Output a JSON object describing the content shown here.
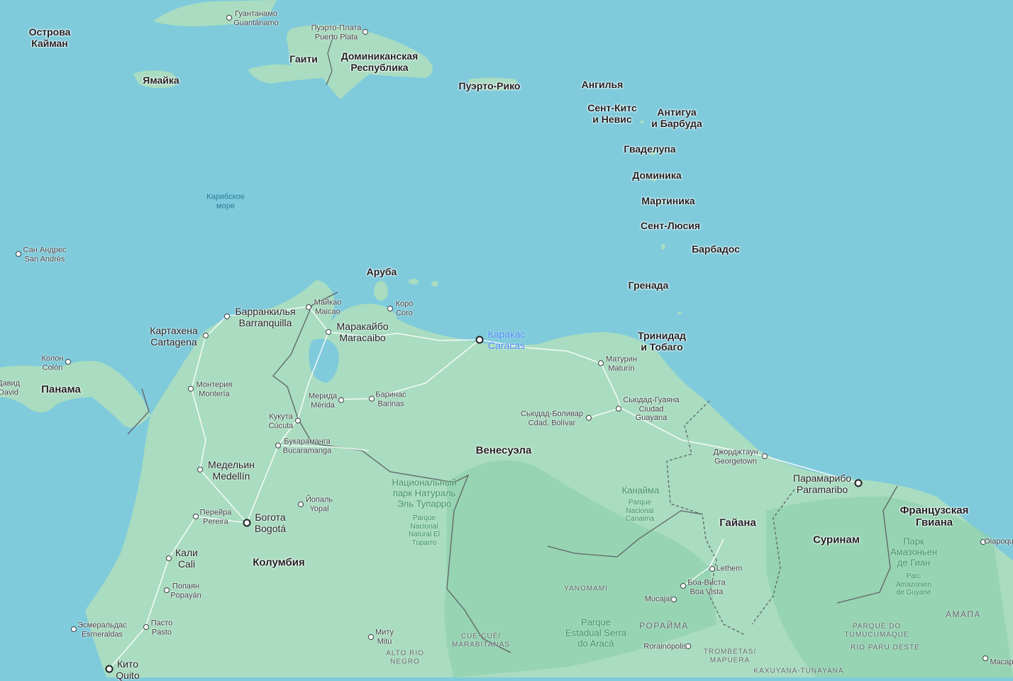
{
  "colors": {
    "water": "#7fcbdc",
    "land": "#a9dcc0",
    "land_dark": "#8fd0ae",
    "border": "#5f6368",
    "road": "#ffffff"
  },
  "countries": {
    "cayman": "Острова\nКайман",
    "jamaica": "Ямайка",
    "haiti": "Гаити",
    "dominican": "Доминиканская\nРеспублика",
    "puerto_rico": "Пуэрто-Рико",
    "anguilla": "Ангилья",
    "st_kitts": "Сент-Китс\nи Невис",
    "antigua": "Антигуа\nи Барбуда",
    "guadeloupe": "Гваделупа",
    "dominica": "Доминика",
    "martinique": "Мартиника",
    "st_lucia": "Сент-Люсия",
    "barbados": "Барбадос",
    "grenada": "Гренада",
    "trinidad": "Тринидад\nи Тобаго",
    "aruba": "Аруба",
    "panama": "Панама",
    "venezuela": "Венесуэла",
    "colombia": "Колумбия",
    "guyana": "Гайана",
    "suriname": "Суринам",
    "french_guiana": "Французская\nГвиана"
  },
  "sea": {
    "caribbean": "Карибское\nморе"
  },
  "cities": {
    "guantanamo": "Гуантанамо\nGuantánamo",
    "puerto_plata": "Пуэрто-Плата\nPuerto Plata",
    "san_andres": "Сан Андрес\nSan Andrés",
    "maicao": "Майкао\nMaicao",
    "coro": "Коро\nCoro",
    "barranquilla": "Барранкилья\nBarranquilla",
    "maracaibo": "Маракайбо\nMaracaibo",
    "cartagena": "Картахена\nCartagena",
    "colon": "Колон\nColón",
    "david": "Давид\nDavid",
    "maturin": "Матурин\nMaturín",
    "monteria": "Монтерия\nMontería",
    "merida": "Мерида\nMérida",
    "barinas": "Баринас\nBarinas",
    "cucuta": "Кукута\nCúcuta",
    "ciudad_guayana": "Сьюдад-Гуаяна\nCiudad\nGuayana",
    "ciudad_bolivar": "Сьюдад-Боливар\nCdad. Bolívar",
    "bucaramanga": "Букараманга\nBucaramanga",
    "georgetown": "Джорджтаун\nGeorgetown",
    "medellin": "Медельин\nMedellín",
    "paramaribo": "Парамарибо\nParamaribo",
    "yopal": "Йопаль\nYopal",
    "pereira": "Перейра\nPereira",
    "bogota": "Богота\nBogotá",
    "cali": "Кали\nCali",
    "popayan": "Попаян\nPopayán",
    "esmeraldas": "Эсмеральдас\nEsmeraldas",
    "pasto": "Пасто\nPasto",
    "quito": "Кито\nQuito",
    "mitu": "Миту\nMitú",
    "lethem": "Lethem",
    "boa_vista": "Боа-Виста\nBoa Vista",
    "mucajai": "Mucajaí",
    "rorainopolis": "Rorainópolis",
    "oiapoque": "Oiapoque",
    "macapa": "Macap"
  },
  "capital_caracas": "Каракас\nCaracas",
  "parks": {
    "tuparro": "Национальный\nпарк Натураль\nЭль Тупарро",
    "tuparro_es": "Parque\nNacional\nNatural El\nTuparro",
    "canaima": "Канайма",
    "canaima_es": "Parque\nNacional\nCanaima",
    "amazonien": "Парк\nАмазоньен\nде Гиан",
    "amazonien_fr": "Parc\nAmazonien\nde Guyane",
    "araca": "Parque\nEstadual Serra\ndo Aracá"
  },
  "regions": {
    "yanomami": "YANOMAMI",
    "roraima": "РОРАЙМА",
    "amapa": "АМАПА",
    "cue_cue": "CUE-CUÉ/\nMARABITANAS",
    "alto_rio_negro": "ALTO RIO\nNEGRO",
    "trombetas": "TROMBETAS/\nMAPUERA",
    "kaxuyana": "KAXUYANA-TUNAYANA",
    "tumucumaque": "PARQUE DO\nTUMUCUMAQUE",
    "rio_paru": "RIO PARU DESTE"
  }
}
